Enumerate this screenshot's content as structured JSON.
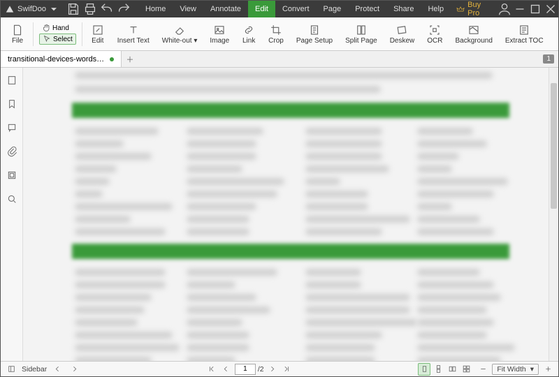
{
  "app": {
    "name": "SwifDoo"
  },
  "menu": {
    "items": [
      "Home",
      "View",
      "Annotate",
      "Edit",
      "Convert",
      "Page",
      "Protect",
      "Share",
      "Help"
    ],
    "active_index": 3,
    "buy_pro": "Buy Pro"
  },
  "file_hand": {
    "hand": "Hand",
    "select": "Select"
  },
  "toolbar": {
    "file": "File",
    "items": [
      {
        "id": "edit",
        "label": "Edit"
      },
      {
        "id": "insert-text",
        "label": "Insert Text"
      },
      {
        "id": "white-out",
        "label": "White-out",
        "dropdown": true
      },
      {
        "id": "image",
        "label": "Image"
      },
      {
        "id": "link",
        "label": "Link"
      },
      {
        "id": "crop",
        "label": "Crop"
      },
      {
        "id": "page-setup",
        "label": "Page Setup"
      },
      {
        "id": "split-page",
        "label": "Split Page"
      },
      {
        "id": "deskew",
        "label": "Deskew"
      },
      {
        "id": "ocr",
        "label": "OCR"
      },
      {
        "id": "background",
        "label": "Background"
      },
      {
        "id": "extract-toc",
        "label": "Extract TOC"
      }
    ]
  },
  "tabs": {
    "items": [
      {
        "name": "transitional-devices-words-an...",
        "modified": true
      }
    ],
    "badge": "1"
  },
  "statusbar": {
    "sidebar_label": "Sidebar",
    "page_current": "1",
    "page_total": "/2",
    "zoom_label": "Fit Width"
  },
  "colors": {
    "accent": "#3a9a3a"
  }
}
